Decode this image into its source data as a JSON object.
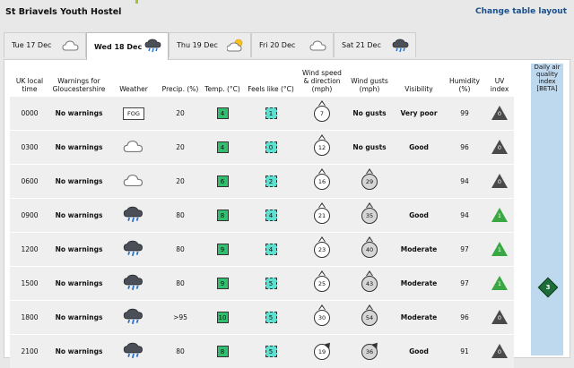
{
  "page": {
    "title": "St Briavels Youth Hostel",
    "change_layout": "Change table layout"
  },
  "tabs": [
    {
      "label": "Tue 17 Dec",
      "icon": "cloud-icon",
      "active": false
    },
    {
      "label": "Wed 18 Dec",
      "icon": "rain-cloud-icon",
      "active": true
    },
    {
      "label": "Thu 19 Dec",
      "icon": "sun-cloud-icon",
      "active": false
    },
    {
      "label": "Fri 20 Dec",
      "icon": "cloud-icon",
      "active": false
    },
    {
      "label": "Sat 21 Dec",
      "icon": "rain-cloud-icon",
      "active": false
    }
  ],
  "headers": {
    "time": "UK local time",
    "warnings": "Warnings for Gloucestershire",
    "weather": "Weather",
    "precip": "Precip. (%)",
    "temp": "Temp. (°C)",
    "feels": "Feels like (°C)",
    "wind": "Wind speed & direction (mph)",
    "gusts": "Wind gusts (mph)",
    "visibility": "Visibility",
    "humidity": "Humidity (%)",
    "uv": "UV index",
    "aq": "Daily air quality index [BETA]"
  },
  "air_quality": {
    "value": "3",
    "color": "#1d6d3a"
  },
  "rows": [
    {
      "time": "0000",
      "warnings": "No warnings",
      "weather": "fog",
      "weather_label": "FOG",
      "precip": "20",
      "temp": "4",
      "feels": "1",
      "wind": "7",
      "wind_dir": "n",
      "gusts": "No gusts",
      "visibility": "Very poor",
      "humidity": "99",
      "uv": "0"
    },
    {
      "time": "0300",
      "warnings": "No warnings",
      "weather": "cloud-icon",
      "weather_label": "",
      "precip": "20",
      "temp": "4",
      "feels": "0",
      "wind": "12",
      "wind_dir": "n",
      "gusts": "No gusts",
      "visibility": "Good",
      "humidity": "96",
      "uv": "0"
    },
    {
      "time": "0600",
      "warnings": "No warnings",
      "weather": "cloud-icon",
      "weather_label": "",
      "precip": "20",
      "temp": "6",
      "feels": "2",
      "wind": "16",
      "wind_dir": "n",
      "gusts": "29",
      "visibility": "",
      "humidity": "94",
      "uv": "0"
    },
    {
      "time": "0900",
      "warnings": "No warnings",
      "weather": "rain-cloud-icon",
      "weather_label": "",
      "precip": "80",
      "temp": "8",
      "feels": "4",
      "wind": "21",
      "wind_dir": "n",
      "gusts": "35",
      "visibility": "Good",
      "humidity": "94",
      "uv": "1"
    },
    {
      "time": "1200",
      "warnings": "No warnings",
      "weather": "rain-cloud-icon",
      "weather_label": "",
      "precip": "80",
      "temp": "9",
      "feels": "4",
      "wind": "23",
      "wind_dir": "n",
      "gusts": "40",
      "visibility": "Moderate",
      "humidity": "97",
      "uv": "1"
    },
    {
      "time": "1500",
      "warnings": "No warnings",
      "weather": "rain-cloud-icon",
      "weather_label": "",
      "precip": "80",
      "temp": "9",
      "feels": "5",
      "wind": "25",
      "wind_dir": "n",
      "gusts": "43",
      "visibility": "Moderate",
      "humidity": "97",
      "uv": "1"
    },
    {
      "time": "1800",
      "warnings": "No warnings",
      "weather": "rain-cloud-icon",
      "weather_label": "",
      "precip": ">95",
      "temp": "10",
      "feels": "5",
      "wind": "30",
      "wind_dir": "n",
      "gusts": "54",
      "visibility": "Moderate",
      "humidity": "96",
      "uv": "0"
    },
    {
      "time": "2100",
      "warnings": "No warnings",
      "weather": "rain-cloud-icon",
      "weather_label": "",
      "precip": "80",
      "temp": "8",
      "feels": "5",
      "wind": "19",
      "wind_dir": "ne",
      "gusts": "36",
      "visibility": "Good",
      "humidity": "91",
      "uv": "0"
    }
  ]
}
